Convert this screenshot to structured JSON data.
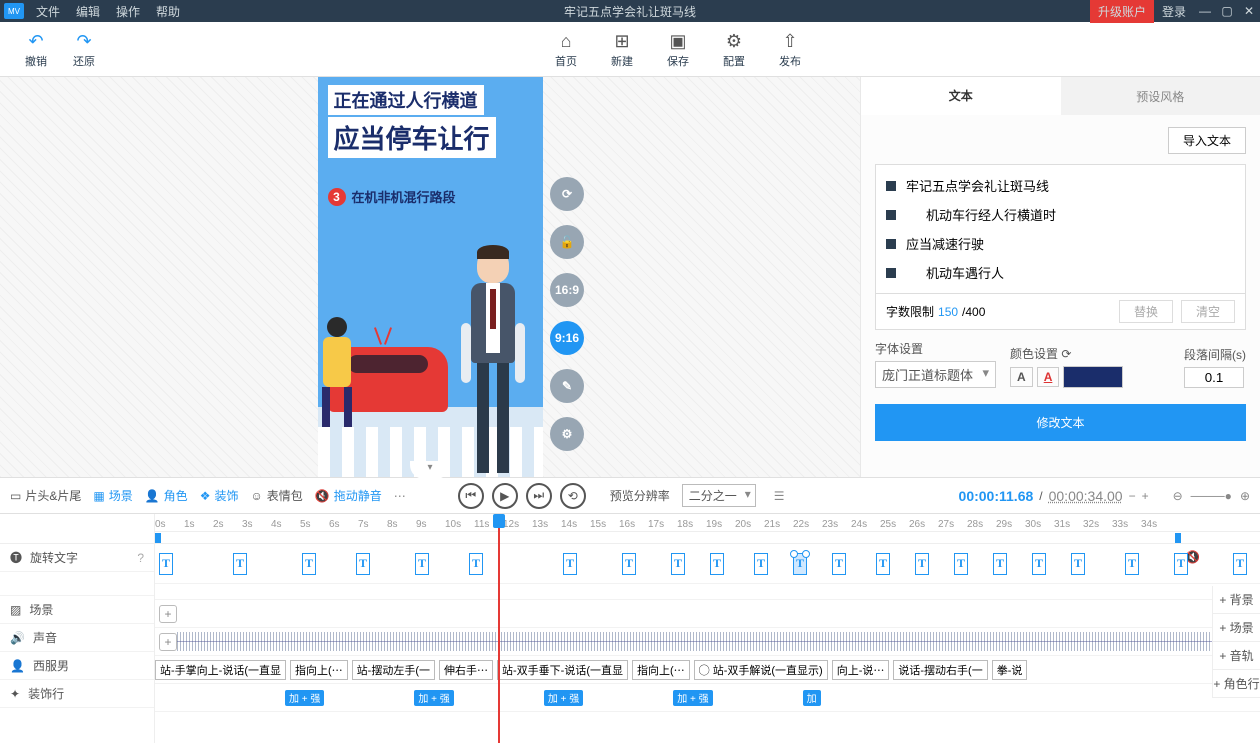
{
  "titlebar": {
    "logo": "MV",
    "menus": [
      "文件",
      "编辑",
      "操作",
      "帮助"
    ],
    "title": "牢记五点学会礼让斑马线",
    "upgrade": "升级账户",
    "login": "登录"
  },
  "toolbar": {
    "undo": "撤销",
    "redo": "还原",
    "home": "首页",
    "new": "新建",
    "save": "保存",
    "config": "配置",
    "publish": "发布"
  },
  "canvas": {
    "line1": "正在通过人行横道",
    "line2": "应当停车让行",
    "badge": "3",
    "line3": "在机非机混行路段",
    "side_buttons": {
      "refresh": "⟳",
      "lock": "🔓",
      "ratio1": "16:9",
      "ratio2": "9:16",
      "edit": "✎",
      "settings": "⚙"
    }
  },
  "right_panel": {
    "tabs": {
      "text": "文本",
      "preset": "预设风格"
    },
    "import": "导入文本",
    "items": [
      "牢记五点学会礼让斑马线",
      "机动车行经人行横道时",
      "应当减速行驶",
      "机动车遇行人"
    ],
    "limit_label": "字数限制",
    "limit_current": "150",
    "limit_sep": " /400",
    "replace": "替换",
    "clear": "清空",
    "font_label": "字体设置",
    "color_label": "颜色设置 ⟳",
    "spacing_label": "段落间隔(s)",
    "font_value": "庞门正道标题体",
    "color_value": "#1a2d6b",
    "spacing_value": "0.1",
    "modify": "修改文本"
  },
  "tl_controls": {
    "tags": {
      "head_tail": "片头&片尾",
      "scene": "场景",
      "role": "角色",
      "decor": "装饰",
      "emoji": "表情包",
      "mute": "拖动静音"
    },
    "preview_label": "预览分辨率",
    "preview_value": "二分之一",
    "time_current": "00:00:11.68",
    "time_sep": " / ",
    "time_total": "00:00:34.00"
  },
  "timeline": {
    "ruler": [
      "0s",
      "1s",
      "2s",
      "3s",
      "4s",
      "5s",
      "6s",
      "7s",
      "8s",
      "9s",
      "10s",
      "11s",
      "12s",
      "13s",
      "14s",
      "15s",
      "16s",
      "17s",
      "18s",
      "19s",
      "20s",
      "21s",
      "22s",
      "23s",
      "24s",
      "25s",
      "26s",
      "27s",
      "28s",
      "29s",
      "30s",
      "31s",
      "32s",
      "33s",
      "34s"
    ],
    "tracks": {
      "text": "旋转文字",
      "scene": "场景",
      "sound": "声音",
      "man": "西服男",
      "decor": "装饰行"
    },
    "side_adds": [
      "+ 背景",
      "+ 场景",
      "+ 音轨",
      "+ 角色行"
    ],
    "clips_man": [
      "站-手掌向上-说话(一直显",
      "指向上(⋯",
      "站-摆动左手(一",
      "伸右手⋯",
      "站-双手垂下-说话(一直显",
      "指向上(⋯",
      "◯ 站-双手解说(一直显示)",
      "向上-说⋯",
      "说话-摆动右手(一",
      "拳-说"
    ],
    "blue_blocks": [
      "加 + 强",
      "加 + 强",
      "加 + 强",
      "加 + 强",
      "加"
    ]
  }
}
